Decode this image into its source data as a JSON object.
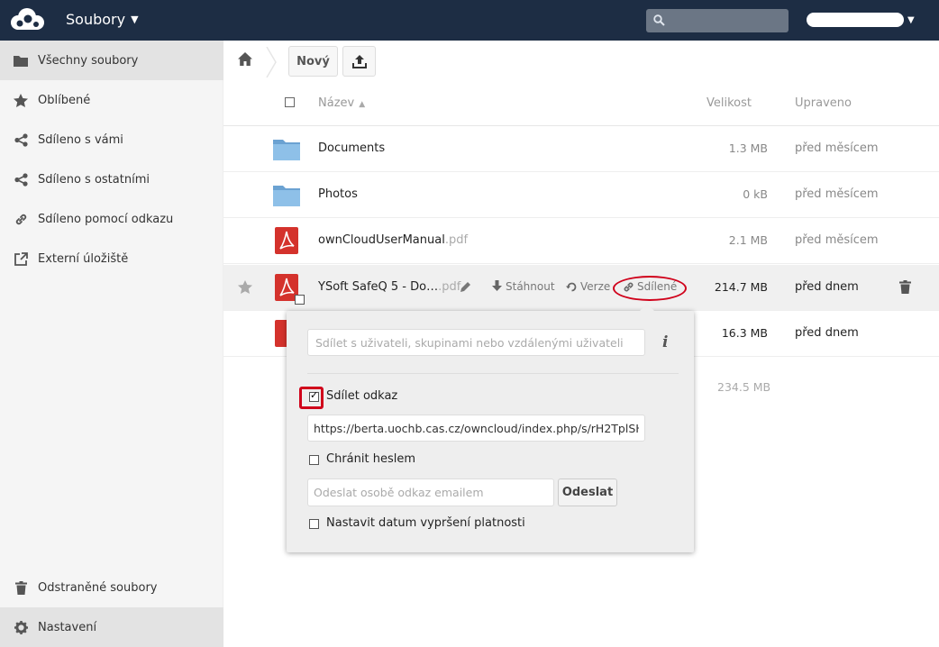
{
  "header": {
    "app_name": "Soubory",
    "search_placeholder": "",
    "user_name": ""
  },
  "sidebar": {
    "items": [
      {
        "label": "Všechny soubory",
        "icon": "folder-icon"
      },
      {
        "label": "Oblíbené",
        "icon": "star-icon"
      },
      {
        "label": "Sdíleno s vámi",
        "icon": "share-icon"
      },
      {
        "label": "Sdíleno s ostatními",
        "icon": "share-icon"
      },
      {
        "label": "Sdíleno pomocí odkazu",
        "icon": "link-icon"
      },
      {
        "label": "Externí úložiště",
        "icon": "external-icon"
      }
    ],
    "deleted": "Odstraněné soubory",
    "settings": "Nastavení"
  },
  "controls": {
    "new_label": "Nový"
  },
  "table": {
    "col_name": "Název",
    "col_size": "Velikost",
    "col_modified": "Upraveno",
    "rows": [
      {
        "name": "Documents",
        "ext": "",
        "size": "1.3 MB",
        "modified": "před měsícem",
        "type": "folder"
      },
      {
        "name": "Photos",
        "ext": "",
        "size": "0 kB",
        "modified": "před měsícem",
        "type": "folder"
      },
      {
        "name": "ownCloudUserManual",
        "ext": ".pdf",
        "size": "2.1 MB",
        "modified": "před měsícem",
        "type": "pdf"
      },
      {
        "name": "YSoft SafeQ 5 - Do…",
        "ext": ".pdf",
        "size": "214.7 MB",
        "modified": "před dnem",
        "type": "pdf"
      },
      {
        "name": "",
        "ext": "",
        "size": "16.3 MB",
        "modified": "před dnem",
        "type": "pdf"
      }
    ],
    "actions": {
      "download": "Stáhnout",
      "versions": "Verze",
      "shared": "Sdílené"
    },
    "summary_size": "234.5 MB"
  },
  "share": {
    "share_with_placeholder": "Sdílet s uživateli, skupinami nebo vzdálenými uživateli",
    "share_link_label": "Sdílet odkaz",
    "share_link_checked": true,
    "link_url": "https://berta.uochb.cas.cz/owncloud/index.php/s/rH2TplSH:",
    "password_label": "Chránit heslem",
    "email_placeholder": "Odeslat osobě odkaz emailem",
    "send_label": "Odeslat",
    "expiration_label": "Nastavit datum vypršení platnosti"
  },
  "colors": {
    "header_bg": "#1d2d44",
    "highlight_red": "#d0021b",
    "folder_blue": "#7fb1dc",
    "pdf_red": "#d4322c"
  }
}
